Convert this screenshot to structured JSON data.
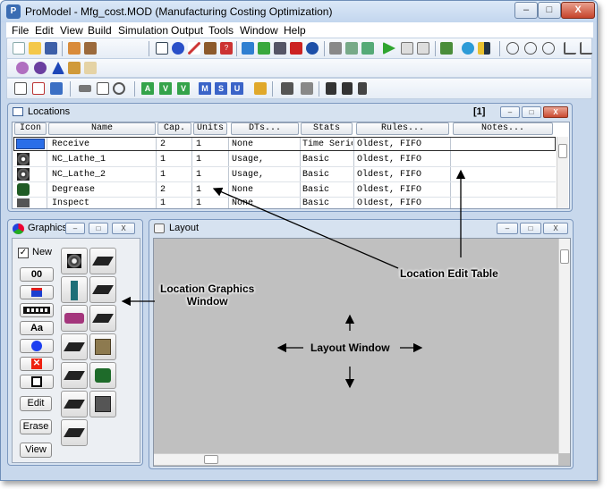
{
  "window": {
    "title": "ProModel - Mfg_cost.MOD (Manufacturing Costing Optimization)",
    "app_icon_letter": "P",
    "minimize_glyph": "–",
    "maximize_glyph": "□",
    "close_glyph": "X"
  },
  "menu": [
    "File",
    "Edit",
    "View",
    "Build",
    "Simulation",
    "Output",
    "Tools",
    "Window",
    "Help"
  ],
  "toolbar": {
    "letter_buttons": [
      "A",
      "V",
      "V",
      "M",
      "S",
      "U"
    ]
  },
  "locations": {
    "title": "Locations",
    "counter": "[1]",
    "columns": [
      "Icon",
      "Name",
      "Cap.",
      "Units",
      "DTs...",
      "Stats",
      "Rules...",
      "Notes..."
    ],
    "rows": [
      {
        "name": "Receive",
        "cap": "2",
        "units": "1",
        "dts": "None",
        "stats": "Time Serie",
        "rules": "Oldest, FIFO",
        "notes": ""
      },
      {
        "name": "NC_Lathe_1",
        "cap": "1",
        "units": "1",
        "dts": "Usage,",
        "stats": "Basic",
        "rules": "Oldest, FIFO",
        "notes": ""
      },
      {
        "name": "NC_Lathe_2",
        "cap": "1",
        "units": "1",
        "dts": "Usage,",
        "stats": "Basic",
        "rules": "Oldest, FIFO",
        "notes": ""
      },
      {
        "name": "Degrease",
        "cap": "2",
        "units": "1",
        "dts": "None",
        "stats": "Basic",
        "rules": "Oldest, FIFO",
        "notes": ""
      },
      {
        "name": "Inspect",
        "cap": "1",
        "units": "1",
        "dts": "None",
        "stats": "Basic",
        "rules": "Oldest, FIFO",
        "notes": ""
      }
    ]
  },
  "graphics": {
    "title": "Graphics",
    "new_label": "New",
    "new_checked": true,
    "counter_label": "00",
    "text_tool_label": "Aa",
    "edit_label": "Edit",
    "erase_label": "Erase",
    "view_label": "View"
  },
  "layout": {
    "title": "Layout"
  },
  "annotations": {
    "location_edit_table": "Location Edit Table",
    "location_graphics_window": "Location Graphics\nWindow",
    "layout_window": "Layout Window"
  },
  "colors": {
    "titlebar": "#c3d6ee",
    "menu_bg": "#ffffff",
    "panel_bg": "#d6e2f0",
    "layout_canvas": "#c0c0c0",
    "selected_row": "#2a6ee8",
    "close_red": "#c94a31"
  }
}
